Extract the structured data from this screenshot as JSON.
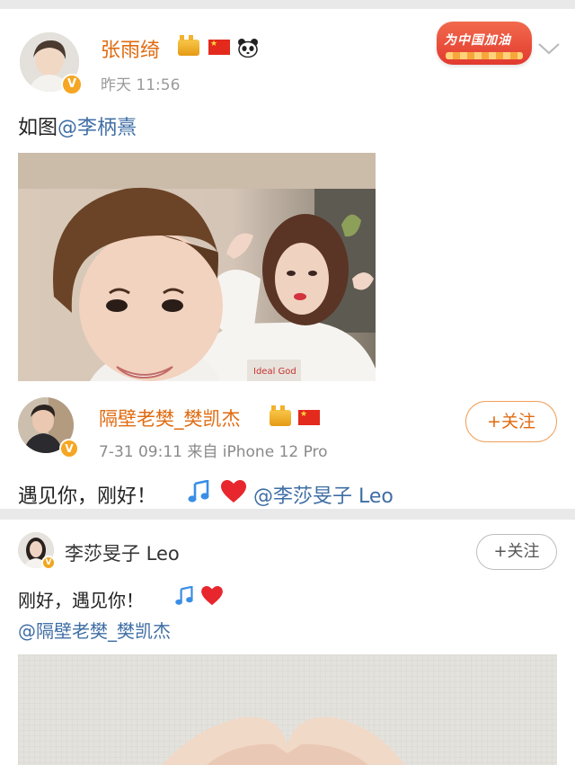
{
  "post1": {
    "username": "张雨绮",
    "time": "昨天 11:56",
    "text_prefix": "如图",
    "mention": "@李柄熹",
    "promo_label": "为中国加油"
  },
  "post2": {
    "username": "隔壁老樊_樊凯杰",
    "meta": "7-31 09:11  来自 iPhone 12 Pro",
    "follow_label": "+关注",
    "text_prefix": "遇见你，刚好！",
    "mention": "@李莎旻子 Leo"
  },
  "post3": {
    "username": "李莎旻子 Leo",
    "follow_label": "+关注",
    "text_line1": "刚好，遇见你！",
    "mention": "@隔壁老樊_樊凯杰"
  },
  "colors": {
    "username_orange": "#e06b11",
    "mention_blue": "#3f6ea5",
    "meta_grey": "#9a9a9a",
    "note_blue": "#3a8ee6",
    "heart_red": "#e8262d"
  },
  "icons": [
    "verified-badge-icon",
    "crown-icon",
    "china-flag-icon",
    "panda-icon",
    "chevron-down-icon",
    "music-note-icon",
    "heart-icon"
  ]
}
